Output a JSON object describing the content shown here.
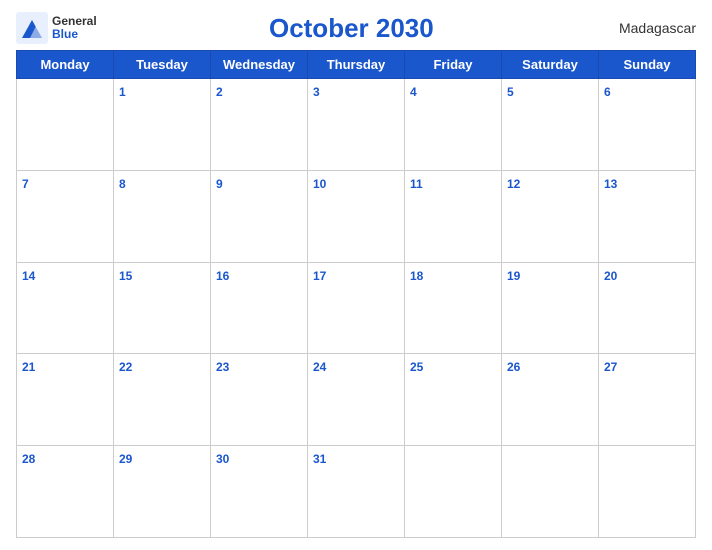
{
  "logo": {
    "general": "General",
    "blue": "Blue"
  },
  "title": "October 2030",
  "country": "Madagascar",
  "weekdays": [
    "Monday",
    "Tuesday",
    "Wednesday",
    "Thursday",
    "Friday",
    "Saturday",
    "Sunday"
  ],
  "weeks": [
    [
      null,
      "1",
      "2",
      "3",
      "4",
      "5",
      "6"
    ],
    [
      "7",
      "8",
      "9",
      "10",
      "11",
      "12",
      "13"
    ],
    [
      "14",
      "15",
      "16",
      "17",
      "18",
      "19",
      "20"
    ],
    [
      "21",
      "22",
      "23",
      "24",
      "25",
      "26",
      "27"
    ],
    [
      "28",
      "29",
      "30",
      "31",
      null,
      null,
      null
    ]
  ]
}
